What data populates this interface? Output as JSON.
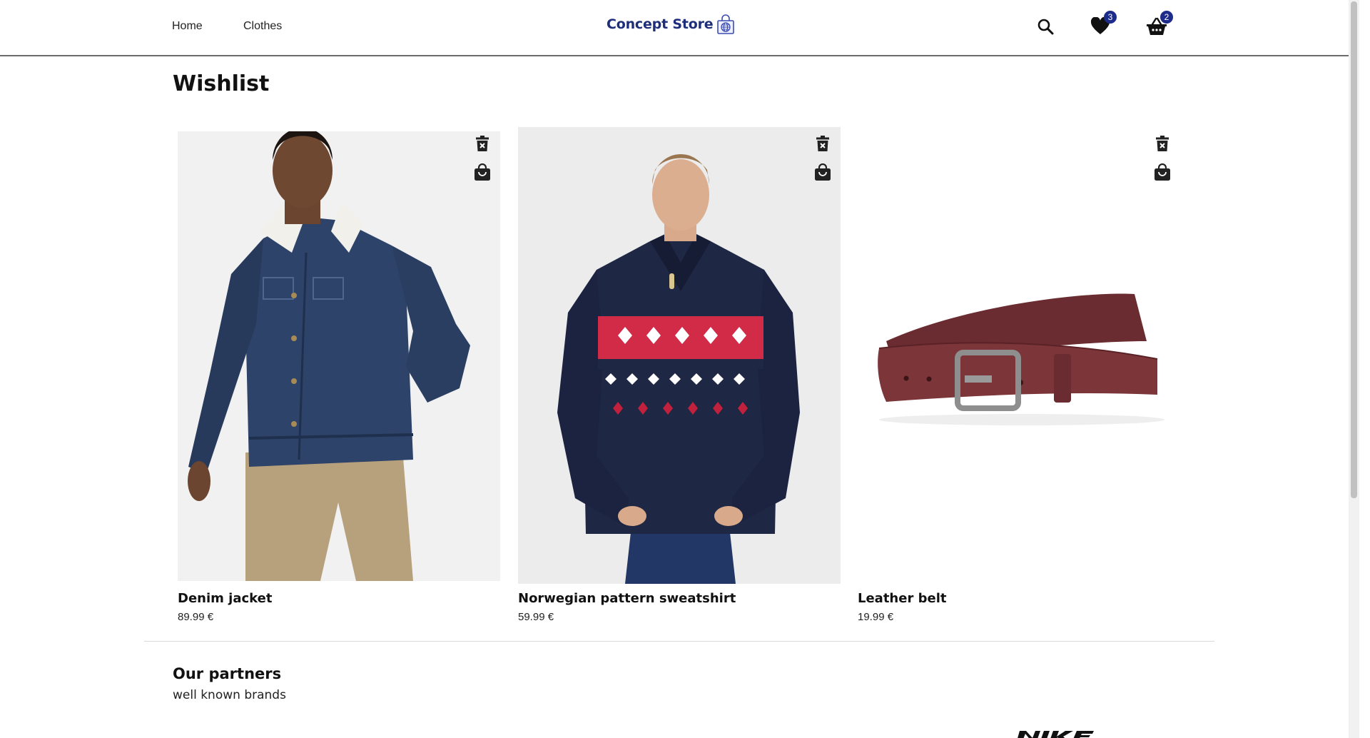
{
  "nav": {
    "home": "Home",
    "clothes": "Clothes"
  },
  "logo": {
    "text": "Concept Store",
    "icon": "shopping-bag-globe-icon",
    "color": "#1f2e7a"
  },
  "header_icons": {
    "search": "search-icon",
    "wishlist": "heart-icon",
    "wishlist_count": "3",
    "cart": "basket-icon",
    "cart_count": "2",
    "badge_color": "#1d2c8a"
  },
  "page": {
    "title": "Wishlist"
  },
  "products": [
    {
      "name": "Denim jacket",
      "price": "89.99 €",
      "image": "man-in-denim-jacket-photo"
    },
    {
      "name": "Norwegian pattern sweatshirt",
      "price": "59.99 €",
      "image": "man-in-norwegian-sweatshirt-photo"
    },
    {
      "name": "Leather belt",
      "price": "19.99 €",
      "image": "burgundy-leather-belt-photo"
    }
  ],
  "card_actions": {
    "remove": "trash-x-icon",
    "add_to_cart": "shopping-bag-icon"
  },
  "partners": {
    "title": "Our partners",
    "subtitle": "well known brands",
    "logo_text": "NIKE"
  }
}
